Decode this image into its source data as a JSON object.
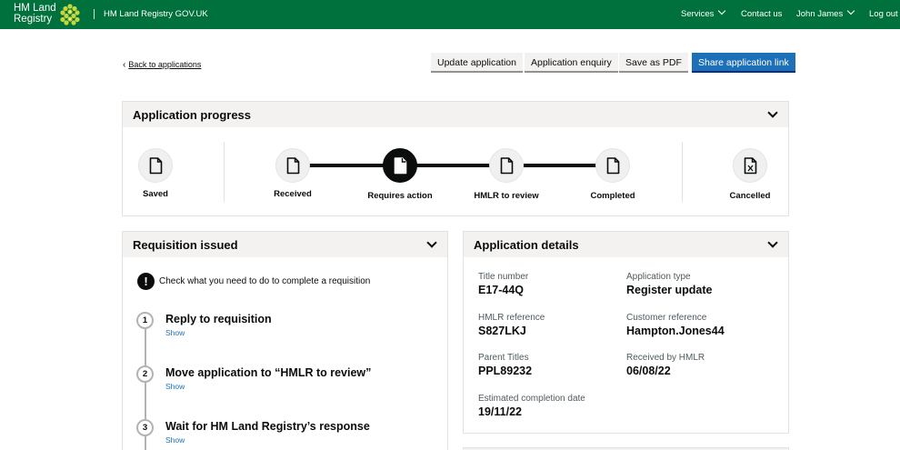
{
  "header": {
    "logo_line1": "HM Land",
    "logo_line2": "Registry",
    "service_name": "HM Land Registry GOV.UK",
    "nav": {
      "services": "Services",
      "contact": "Contact us",
      "user": "John James",
      "logout": "Log out"
    }
  },
  "toolbar": {
    "back_link": "Back to applications",
    "update_application": "Update application",
    "application_enquiry": "Application enquiry",
    "save_pdf": "Save as PDF",
    "share_link": "Share application link"
  },
  "progress": {
    "title": "Application progress",
    "stages": {
      "saved": "Saved",
      "received": "Received",
      "requires_action": "Requires action",
      "hmlr_review": "HMLR to review",
      "completed": "Completed",
      "cancelled": "Cancelled"
    },
    "active_stage": "Requires action"
  },
  "requisition": {
    "title": "Requisition issued",
    "info": "Check what you need to do to complete a requisition",
    "steps": [
      {
        "number": "1",
        "title": "Reply to requisition",
        "show": "Show"
      },
      {
        "number": "2",
        "title": "Move application to “HMLR to review”",
        "show": "Show"
      },
      {
        "number": "3",
        "title": "Wait for HM Land Registry’s response",
        "show": "Show"
      }
    ]
  },
  "details": {
    "title": "Application details",
    "title_number_label": "Title number",
    "title_number": "E17-44Q",
    "application_type_label": "Application type",
    "application_type": "Register update",
    "hmlr_ref_label": "HMLR reference",
    "hmlr_ref": "S827LKJ",
    "customer_ref_label": "Customer reference",
    "customer_ref": "Hampton.Jones44",
    "parent_titles_label": "Parent Titles",
    "parent_titles": "PPL89232",
    "received_label": "Received by HMLR",
    "received": "06/08/22",
    "completion_label": "Estimated completion date",
    "completion": "19/11/22"
  },
  "colors": {
    "header_green": "#00703c",
    "primary_blue": "#1d70b8",
    "panel_grey": "#f3f2f1"
  }
}
